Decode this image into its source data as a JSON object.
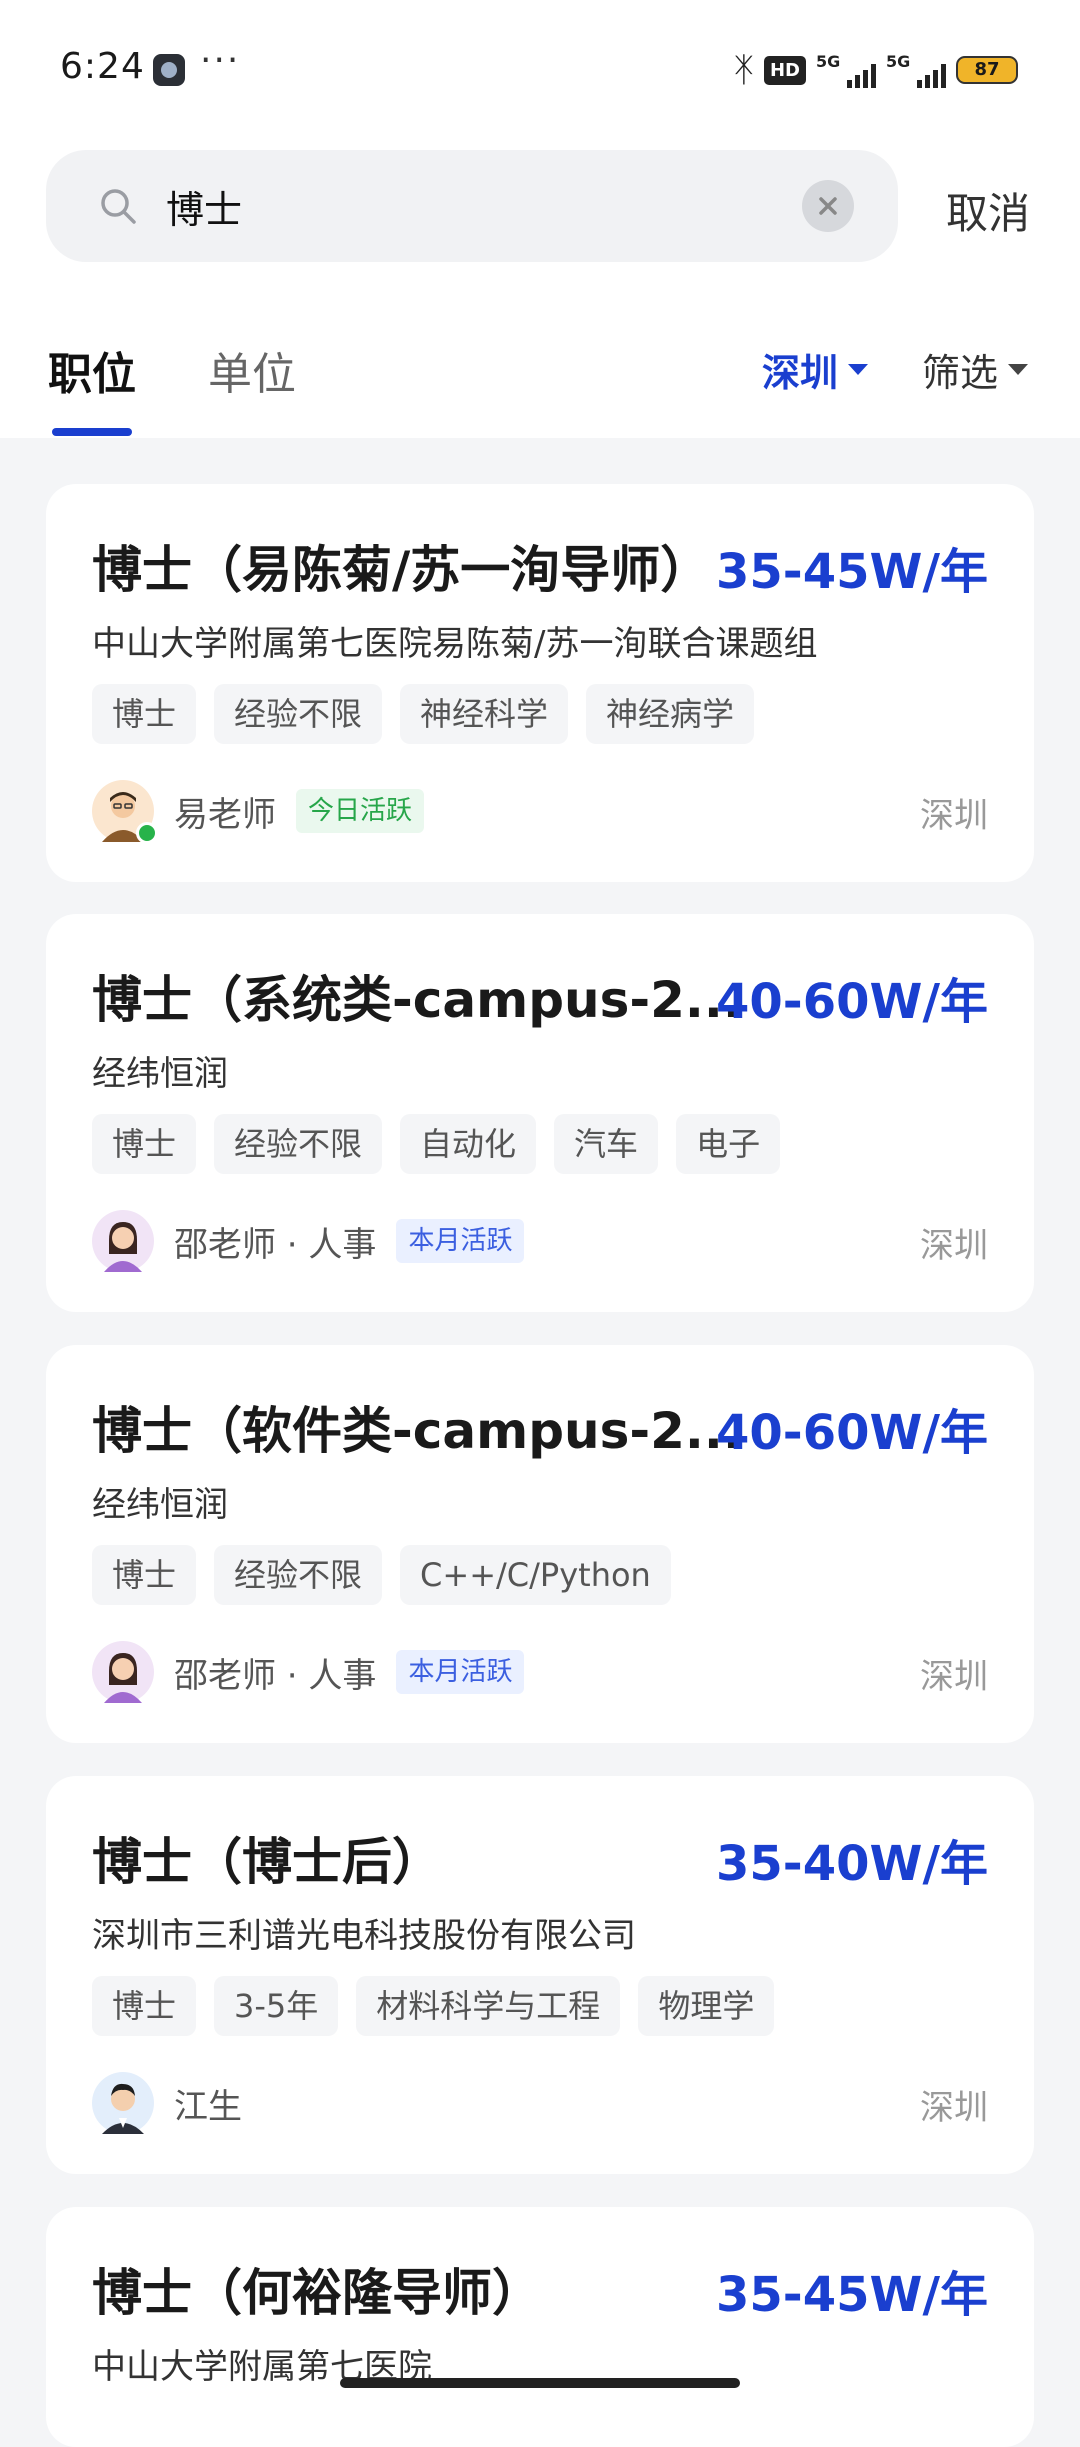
{
  "status_bar": {
    "time": "6:24",
    "dots": "···",
    "network_label": "HD",
    "signal_1": "5G",
    "signal_2": "5G",
    "battery": "87"
  },
  "search": {
    "query": "博士",
    "cancel_label": "取消"
  },
  "tabs": [
    {
      "label": "职位",
      "active": true
    },
    {
      "label": "单位",
      "active": false
    }
  ],
  "filters": {
    "city": "深圳",
    "filter_label": "筛选"
  },
  "jobs": [
    {
      "title": "博士（易陈菊/苏一洵导师）",
      "salary": "35-45W/年",
      "company": "中山大学附属第七医院易陈菊/苏一洵联合课题组",
      "tags": [
        "博士",
        "经验不限",
        "神经科学",
        "神经病学"
      ],
      "recruiter": "易老师",
      "activity": "今日活跃",
      "activity_color": "#27a64a",
      "location": "深圳"
    },
    {
      "title": "博士（系统类-campus-2...",
      "salary": "40-60W/年",
      "company": "经纬恒润",
      "tags": [
        "博士",
        "经验不限",
        "自动化",
        "汽车",
        "电子"
      ],
      "recruiter": "邵老师 · 人事",
      "activity": "本月活跃",
      "activity_color": "#3b5fe0",
      "location": "深圳"
    },
    {
      "title": "博士（软件类-campus-2...",
      "salary": "40-60W/年",
      "company": "经纬恒润",
      "tags": [
        "博士",
        "经验不限",
        "C++/C/Python"
      ],
      "recruiter": "邵老师 · 人事",
      "activity": "本月活跃",
      "activity_color": "#3b5fe0",
      "location": "深圳"
    },
    {
      "title": "博士（博士后）",
      "salary": "35-40W/年",
      "company": "深圳市三利谱光电科技股份有限公司",
      "tags": [
        "博士",
        "3-5年",
        "材料科学与工程",
        "物理学"
      ],
      "recruiter": "江生",
      "activity": "",
      "location": "深圳"
    },
    {
      "title": "博士（何裕隆导师）",
      "salary": "35-45W/年",
      "company": "中山大学附属第七医院"
    }
  ],
  "colors": {
    "accent": "#1a3fcf",
    "background": "#f4f5f7"
  }
}
